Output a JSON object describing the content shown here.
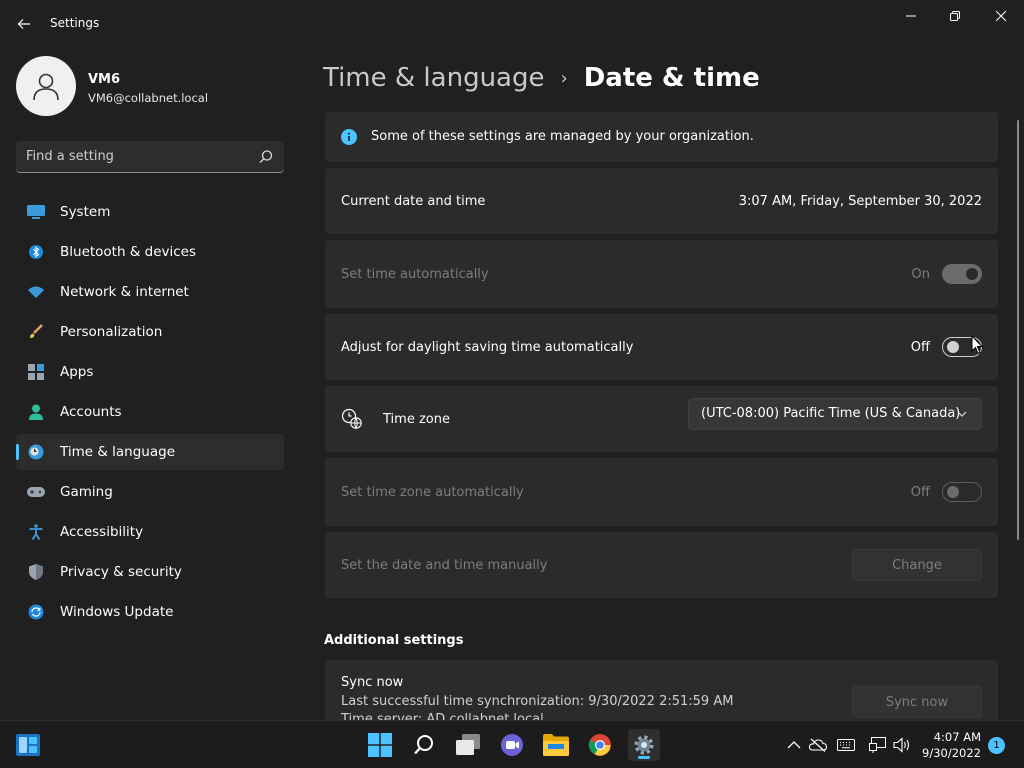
{
  "window": {
    "title": "Settings",
    "controls": [
      "minimize-icon",
      "maximize-icon",
      "close-icon"
    ]
  },
  "profile": {
    "name": "VM6",
    "email": "VM6@collabnet.local"
  },
  "search": {
    "placeholder": "Find a setting"
  },
  "sidebar": {
    "items": [
      {
        "label": "System",
        "icon": "monitor-icon",
        "active": false
      },
      {
        "label": "Bluetooth & devices",
        "icon": "bluetooth-icon",
        "active": false
      },
      {
        "label": "Network & internet",
        "icon": "wifi-icon",
        "active": false
      },
      {
        "label": "Personalization",
        "icon": "brush-icon",
        "active": false
      },
      {
        "label": "Apps",
        "icon": "apps-icon",
        "active": false
      },
      {
        "label": "Accounts",
        "icon": "person-icon",
        "active": false
      },
      {
        "label": "Time & language",
        "icon": "clock-globe-icon",
        "active": true
      },
      {
        "label": "Gaming",
        "icon": "gamepad-icon",
        "active": false
      },
      {
        "label": "Accessibility",
        "icon": "accessibility-icon",
        "active": false
      },
      {
        "label": "Privacy & security",
        "icon": "shield-icon",
        "active": false
      },
      {
        "label": "Windows Update",
        "icon": "update-icon",
        "active": false
      }
    ]
  },
  "breadcrumb": {
    "parent": "Time & language",
    "separator": "›",
    "current": "Date & time"
  },
  "settings": {
    "managed_notice": "Some of these settings are managed by your organization.",
    "current_date_label": "Current date and time",
    "current_date_value": "3:07 AM, Friday, September 30, 2022",
    "set_time_auto_label": "Set time automatically",
    "set_time_auto_state": "On",
    "dst_label": "Adjust for daylight saving time automatically",
    "dst_state": "Off",
    "timezone_label": "Time zone",
    "timezone_value": "(UTC-08:00) Pacific Time (US & Canada)",
    "tz_auto_label": "Set time zone automatically",
    "tz_auto_state": "Off",
    "manual_label": "Set the date and time manually",
    "change_button": "Change",
    "additional_title": "Additional settings",
    "sync_title": "Sync now",
    "sync_last": "Last successful time synchronization: 9/30/2022 2:51:59 AM",
    "sync_server": "Time server: AD.collabnet.local",
    "sync_button": "Sync now"
  },
  "taskbar": {
    "apps": [
      "start-icon",
      "search-icon",
      "task-view-icon",
      "chat-icon",
      "file-explorer-icon",
      "chrome-icon",
      "settings-gear-icon"
    ],
    "tray": [
      "chevron-up-icon",
      "cloud-off-icon",
      "keyboard-icon",
      "network-icon",
      "volume-icon"
    ],
    "time": "4:07 AM",
    "date": "9/30/2022",
    "notifications": "1"
  },
  "colors": {
    "accent": "#4cc2ff",
    "background": "#202020",
    "card": "#2b2b2b"
  }
}
